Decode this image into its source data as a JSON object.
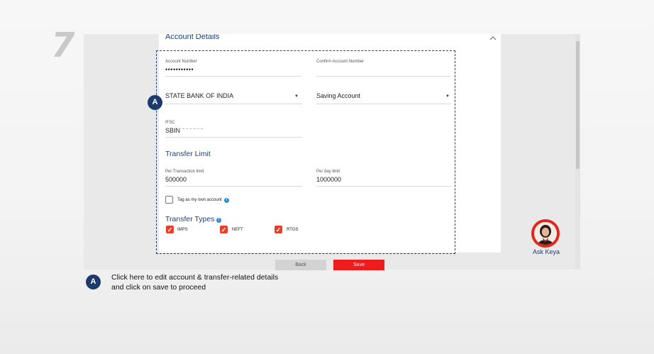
{
  "step": {
    "number": "7"
  },
  "account_details": {
    "title": "Account Details",
    "account_number_label": "Account Number",
    "account_number_value": "•••••••••••",
    "confirm_account_number_label": "Confirm Account Number",
    "confirm_account_number_value": "",
    "bank_name": "STATE BANK OF INDIA",
    "account_type": "Saving Account",
    "ifsc_label": "IFSC",
    "ifsc_value": "SBIN"
  },
  "transfer_limit": {
    "title": "Transfer Limit",
    "per_transaction_label": "Per Transaction limit",
    "per_transaction_value": "500000",
    "per_day_label": "Per day limit",
    "per_day_value": "1000000",
    "own_account_label": "Tag as my own account",
    "own_account_checked": false
  },
  "transfer_types": {
    "title": "Transfer Types",
    "options": [
      {
        "label": "IMPS",
        "checked": true
      },
      {
        "label": "NEFT",
        "checked": true
      },
      {
        "label": "RTGS",
        "checked": true
      }
    ]
  },
  "buttons": {
    "back_label": "Back",
    "save_label": "Save"
  },
  "assistant": {
    "label": "Ask Keya"
  },
  "annotation": {
    "marker": "A",
    "caption_line1": "Click here to edit account & transfer-related details",
    "caption_line2": "and click on save to proceed"
  },
  "colors": {
    "brand_navy": "#1d3f7a",
    "accent_red": "#e6402c",
    "save_red": "#ee1c1c",
    "info_blue": "#2b8ad6"
  },
  "icons": {
    "collapse": "chevron-up-icon",
    "dropdown": "caret-down-icon",
    "info": "info-icon",
    "check": "check-icon"
  }
}
